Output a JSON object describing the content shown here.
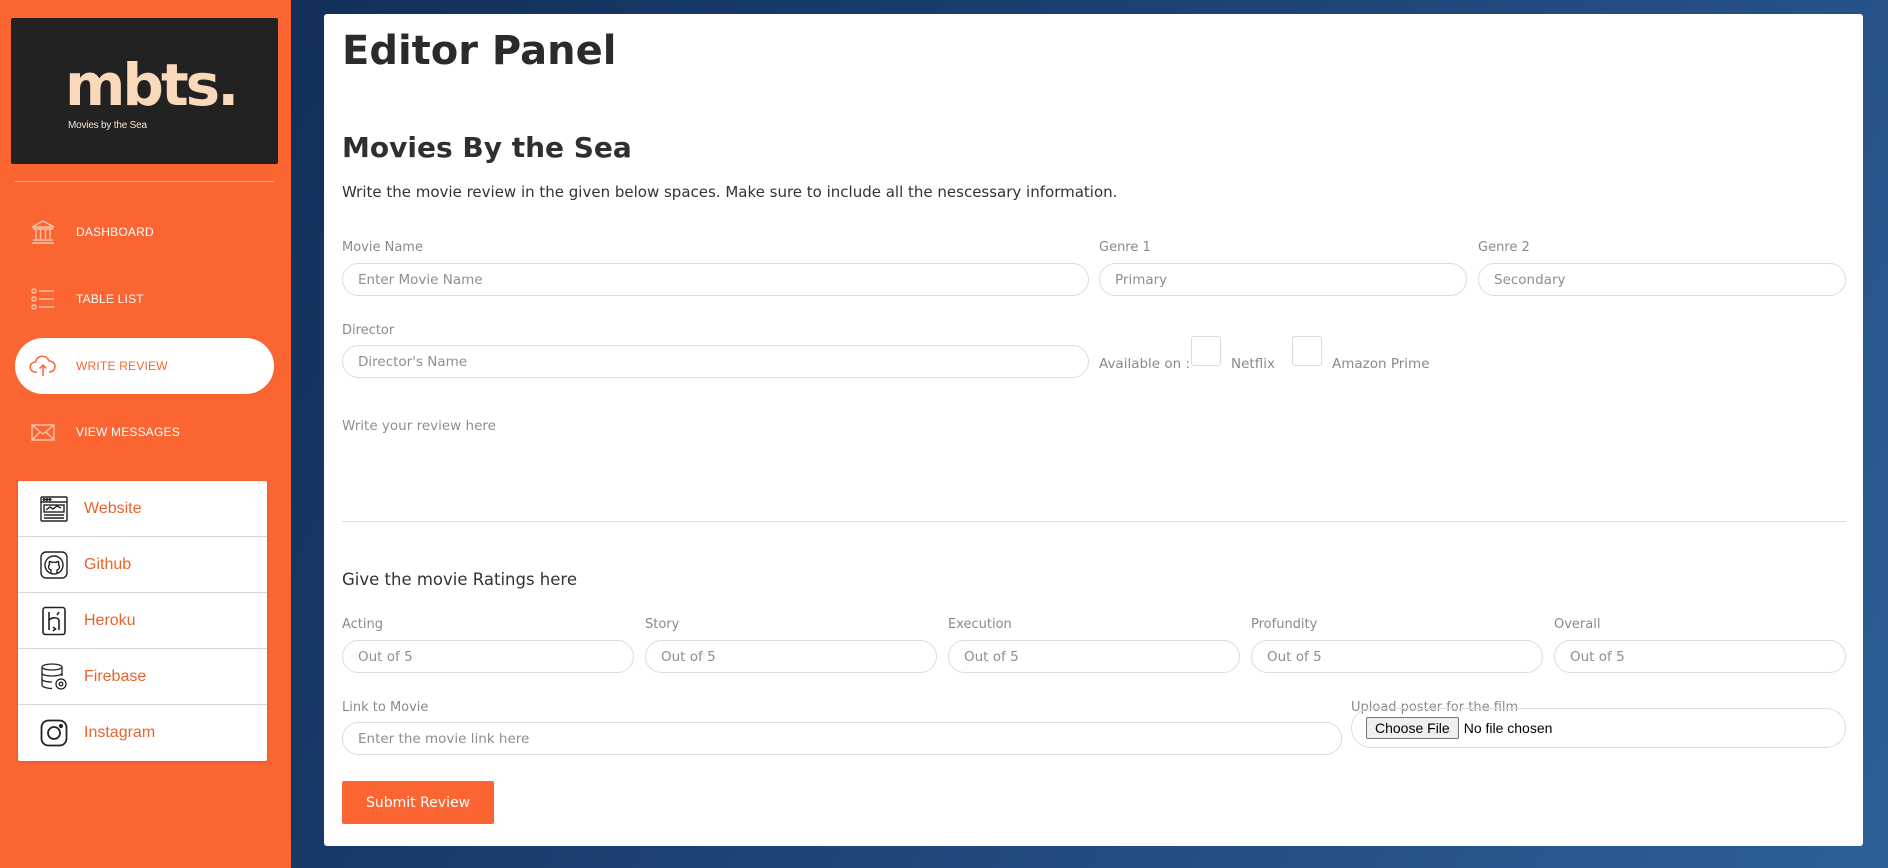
{
  "sidebar": {
    "logo": {
      "text": "mbts.",
      "tagline": "Movies by the Sea"
    },
    "nav": [
      {
        "label": "DASHBOARD",
        "icon": "bank-icon"
      },
      {
        "label": "TABLE LIST",
        "icon": "list-icon"
      },
      {
        "label": "WRITE REVIEW",
        "icon": "cloud-upload-icon",
        "active": true
      },
      {
        "label": "VIEW MESSAGES",
        "icon": "envelope-icon"
      }
    ],
    "links": [
      {
        "label": "Website",
        "icon": "browser-window-icon"
      },
      {
        "label": "Github",
        "icon": "github-icon"
      },
      {
        "label": "Heroku",
        "icon": "heroku-icon"
      },
      {
        "label": "Firebase",
        "icon": "database-icon"
      },
      {
        "label": "Instagram",
        "icon": "instagram-icon"
      }
    ]
  },
  "main": {
    "title": "Editor Panel",
    "section_title": "Movies By the Sea",
    "intro": "Write the movie review in the given below spaces. Make sure to include all the nescessary information.",
    "form": {
      "movie_name": {
        "label": "Movie Name",
        "placeholder": "Enter Movie Name"
      },
      "genre1": {
        "label": "Genre 1",
        "placeholder": "Primary"
      },
      "genre2": {
        "label": "Genre 2",
        "placeholder": "Secondary"
      },
      "director": {
        "label": "Director",
        "placeholder": "Director's Name"
      },
      "available_label": "Available on :",
      "platforms": [
        "Netflix",
        "Amazon Prime"
      ],
      "review_placeholder": "Write your review here",
      "ratings_title": "Give the movie Ratings here",
      "ratings": [
        {
          "label": "Acting",
          "placeholder": "Out of 5"
        },
        {
          "label": "Story",
          "placeholder": "Out of 5"
        },
        {
          "label": "Execution",
          "placeholder": "Out of 5"
        },
        {
          "label": "Profundity",
          "placeholder": "Out of 5"
        },
        {
          "label": "Overall",
          "placeholder": "Out of 5"
        }
      ],
      "link": {
        "label": "Link to Movie",
        "placeholder": "Enter the movie link here"
      },
      "poster": {
        "label": "Upload poster for the film",
        "button": "Choose File",
        "status": "No file chosen"
      },
      "submit": "Submit Review"
    }
  },
  "colors": {
    "accent": "#fb6531",
    "logo_bg": "#222222",
    "logo_text": "#f9d9b9",
    "background_start": "#0e2a50",
    "background_end": "#2e5f99"
  }
}
